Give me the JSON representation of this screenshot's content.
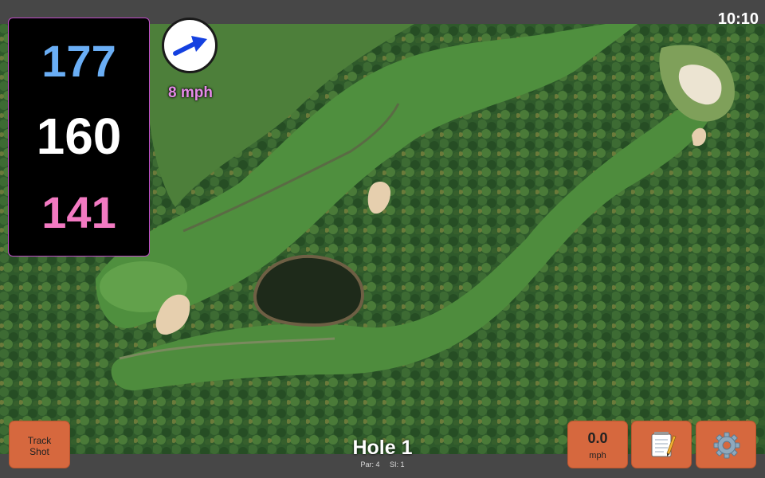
{
  "status_bar": {
    "time": "10:10"
  },
  "yardages": {
    "back": "177",
    "middle": "160",
    "front": "141"
  },
  "wind": {
    "speed": "8 mph",
    "direction_icon": "arrow-right-up-icon"
  },
  "buttons": {
    "track_shot": [
      "Track",
      "Shot"
    ],
    "speed_value": "0.0",
    "speed_unit": "mph",
    "notes_icon": "notepad-icon",
    "settings_icon": "gear-icon"
  },
  "hole": {
    "title": "Hole 1",
    "par": "Par: 4",
    "si": "SI: 1"
  },
  "colors": {
    "back_yardage": "#6aaef5",
    "middle_yardage": "#ffffff",
    "front_yardage": "#f37ac2",
    "accent_border": "#c04ac8",
    "button": "#d6683e",
    "bar": "#474747"
  }
}
